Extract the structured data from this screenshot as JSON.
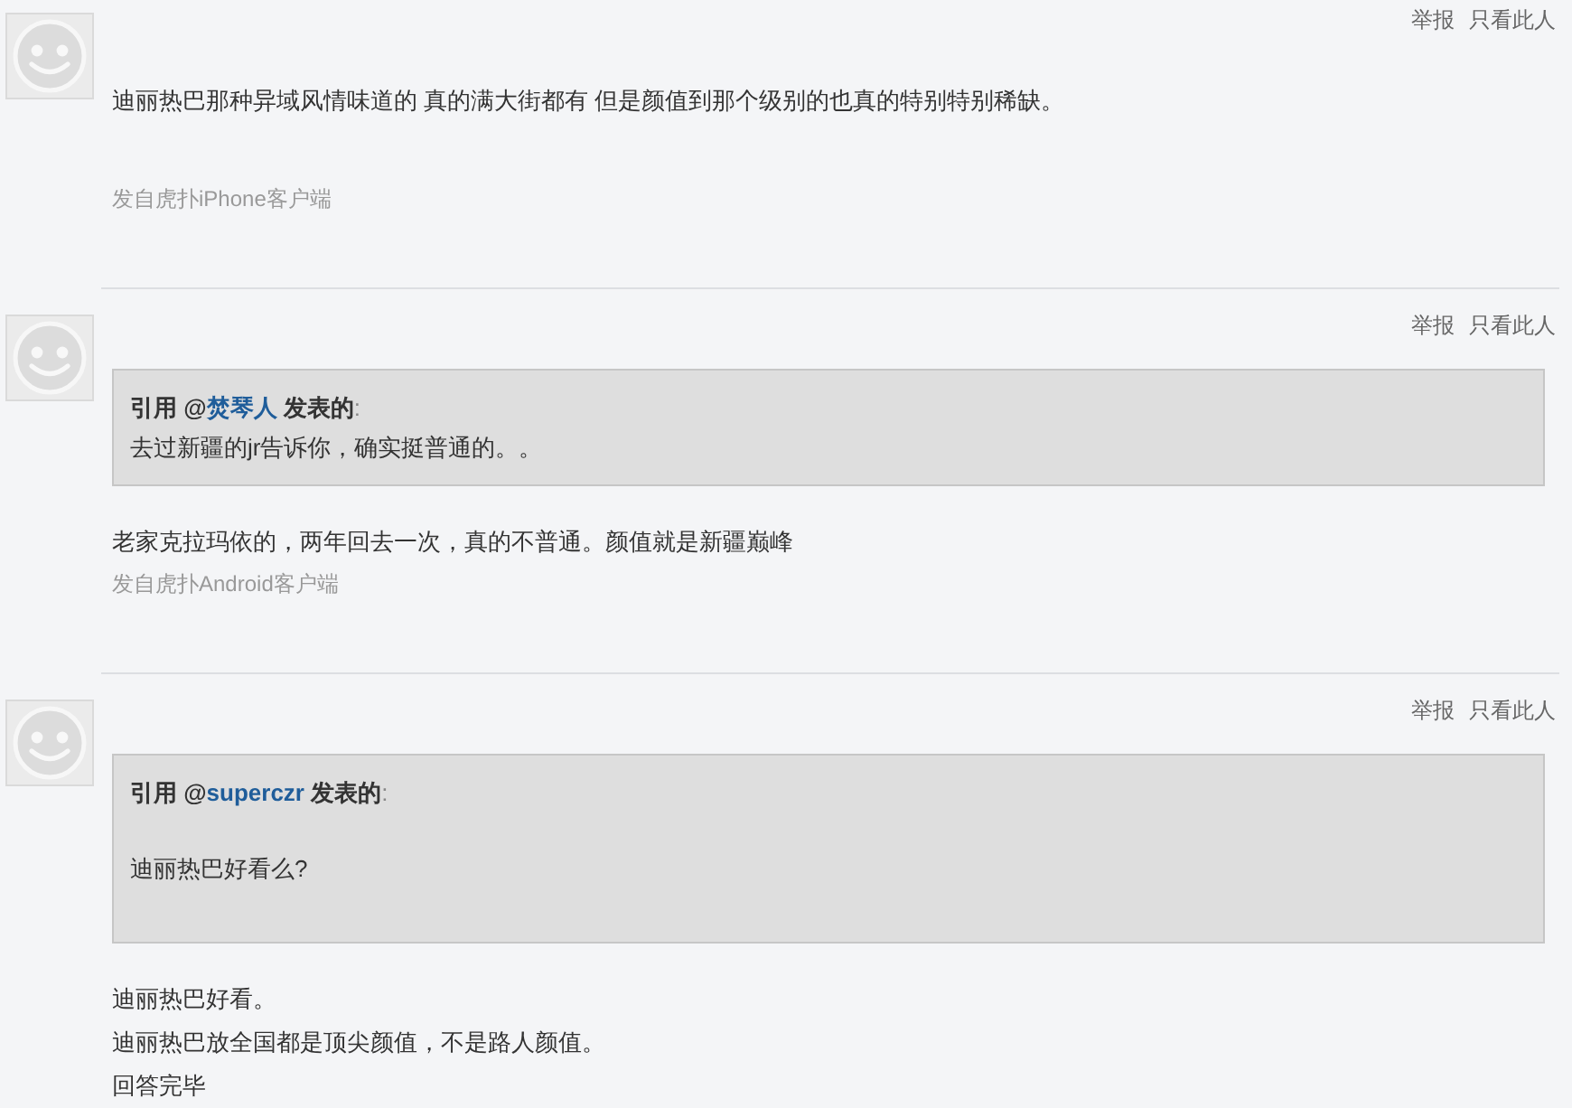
{
  "posts": [
    {
      "actions": [
        "举报",
        "只看此人"
      ],
      "body": [
        "迪丽热巴那种异域风情味道的 真的满大街都有 但是颜值到那个级别的也真的特别特别稀缺。"
      ],
      "source": "发自虎扑iPhone客户端"
    },
    {
      "actions": [
        "举报",
        "只看此人"
      ],
      "quote": {
        "kind": "tight",
        "lead": "引用 @",
        "author": "焚琴人",
        "tail": " 发表的",
        "colon": ":",
        "lines": [
          "去过新疆的jr告诉你，确实挺普通的。。"
        ]
      },
      "body": [
        "老家克拉玛依的，两年回去一次，真的不普通。颜值就是新疆巅峰"
      ],
      "source": "发自虎扑Android客户端"
    },
    {
      "actions": [
        "举报",
        "只看此人"
      ],
      "quote": {
        "kind": "spaced",
        "lead": "引用 @",
        "author": "superczr",
        "tail": " 发表的",
        "colon": ":",
        "lines": [
          "迪丽热巴好看么?"
        ]
      },
      "body": [
        "迪丽热巴好看。",
        "迪丽热巴放全国都是顶尖颜值，不是路人颜值。",
        "回答完毕"
      ]
    }
  ]
}
